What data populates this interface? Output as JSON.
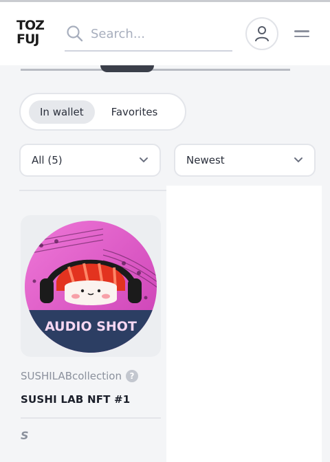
{
  "header": {
    "logo_line1": "TOZ",
    "logo_line2": "FUJ",
    "search_placeholder": "Search..."
  },
  "tabs": [
    {
      "label": "In wallet",
      "active": true
    },
    {
      "label": "Favorites",
      "active": false
    }
  ],
  "filters": {
    "category_selected": "All (5)",
    "sort_selected": "Newest"
  },
  "card": {
    "image_text": "AUDIO SHOT",
    "collection": "SUSHILABcollection",
    "collection_badge": "?",
    "name": "SUSHI LAB NFT #1",
    "price_icon_glyph": "S"
  },
  "colors": {
    "background": "#f4f5f7",
    "card_image_bg": "#eceef1",
    "artwork_pink": "#e455c7",
    "artwork_red": "#e3331f",
    "artwork_banner": "#2c3e63"
  }
}
